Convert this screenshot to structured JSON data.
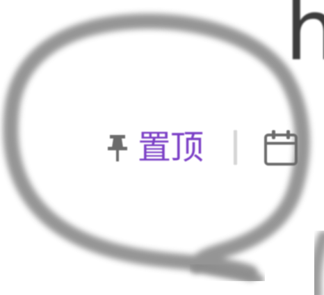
{
  "post_meta": {
    "title_fragment": "h",
    "pin_icon": "pin-icon",
    "pin_label": "置顶",
    "calendar_icon": "calendar-icon"
  },
  "annotation": {
    "type": "hand-drawn-circle",
    "color": "#8a8a8a"
  },
  "colors": {
    "accent": "#7b3fc6",
    "title": "#3c3c3c",
    "divider": "#d6d6d6",
    "icon": "#6b6b6b"
  }
}
